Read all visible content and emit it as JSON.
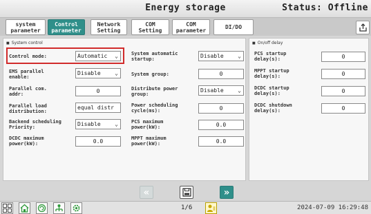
{
  "header": {
    "title": "Energy storage",
    "status": "Status: Offline"
  },
  "tabs": [
    {
      "label": "system\nparameter",
      "active": false
    },
    {
      "label": "Control\nparameter",
      "active": true
    },
    {
      "label": "Network\nSetting",
      "active": false
    },
    {
      "label": "COM\nSetting",
      "active": false
    },
    {
      "label": "COM\nparameter",
      "active": false
    },
    {
      "label": "DI/DO",
      "active": false
    }
  ],
  "system_control": {
    "title": "System control",
    "control_mode": {
      "label": "Control mode:",
      "value": "Automatic"
    },
    "ems_parallel": {
      "label": "EMS parallel\nenable:",
      "value": "Disable"
    },
    "parallel_com_addr": {
      "label": "Parallel com.\naddr:",
      "value": "0"
    },
    "parallel_load_dist": {
      "label": "Parallel load\ndistribution:",
      "value": "equal distr"
    },
    "backend_sched": {
      "label": "Backend scheduling\nPriority:",
      "value": "Disable"
    },
    "dcdc_max_power": {
      "label": "DCDC maximum\npower(kW):",
      "value": "0.0"
    },
    "sys_auto_startup": {
      "label": "System automatic\nstartup:",
      "value": "Disable"
    },
    "system_group": {
      "label": "System group:",
      "value": "0"
    },
    "dist_power_group": {
      "label": "Distribute power\ngroup:",
      "value": "Disable"
    },
    "power_sched_cycle": {
      "label": "Power scheduling\ncycle(ms):",
      "value": "0"
    },
    "pcs_max_power": {
      "label": "PCS maximum\npower(kW):",
      "value": "0.0"
    },
    "mppt_max_power": {
      "label": "MPPT maximum\npower(kW):",
      "value": "0.0"
    }
  },
  "onoff_delay": {
    "title": "On/off delay",
    "pcs_startup": {
      "label": "PCS startup\ndelay(s):",
      "value": "0"
    },
    "mppt_startup": {
      "label": "MPPT startup\ndelay(s):",
      "value": "0"
    },
    "dcdc_startup": {
      "label": "DCDC startup\ndelay(s):",
      "value": "0"
    },
    "dcdc_shutdown": {
      "label": "DCDC shutdown\ndelay(s):",
      "value": "0"
    }
  },
  "pager": {
    "prev": "«",
    "next": "»",
    "page": "1/6"
  },
  "footer": {
    "datetime": "2024-07-09  16:29:48"
  },
  "colors": {
    "accent": "#2f8f8a",
    "highlight": "#d12a2a",
    "green_icon": "#2e9a3a"
  },
  "icons": [
    "grid-icon",
    "home-icon",
    "refresh-icon",
    "network-icon",
    "settings-gear-icon",
    "user-icon",
    "export-icon",
    "save-icon"
  ]
}
